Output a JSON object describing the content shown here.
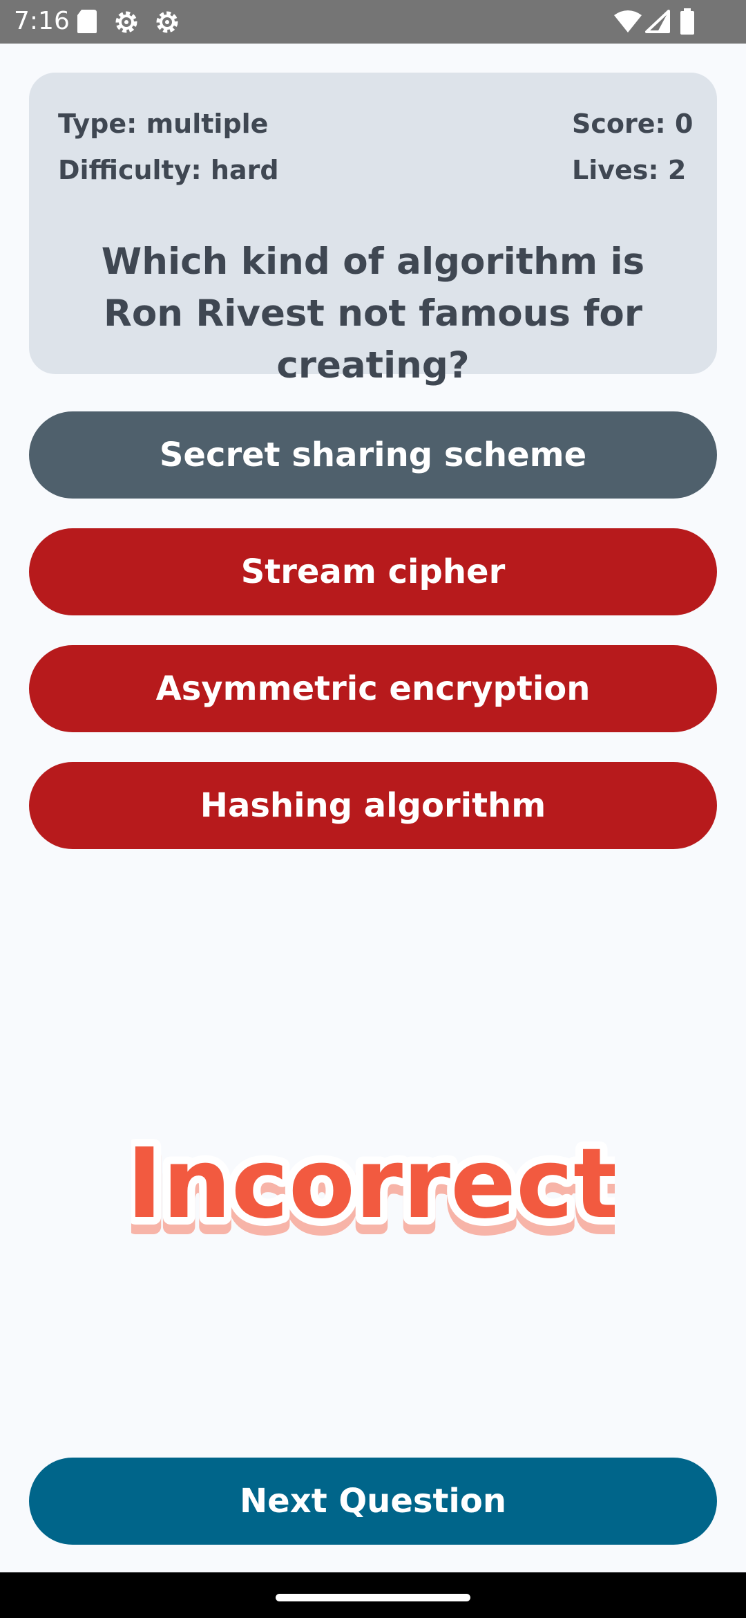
{
  "status_bar": {
    "time": "7:16",
    "icons": [
      "sd-card-icon",
      "settings-icon",
      "settings-icon",
      "wifi-icon",
      "signal-icon",
      "battery-icon"
    ]
  },
  "quiz": {
    "type_label": "Type: multiple",
    "difficulty_label": "Difficulty: hard",
    "score_label": "Score: 0",
    "lives_label": "Lives: 2",
    "question": "Which kind of algorithm is Ron Rivest not famous for creating?"
  },
  "answers": [
    {
      "label": "Secret sharing scheme",
      "state": "correct"
    },
    {
      "label": "Stream cipher",
      "state": "wrong"
    },
    {
      "label": "Asymmetric encryption",
      "state": "wrong"
    },
    {
      "label": "Hashing algorithm",
      "state": "wrong"
    }
  ],
  "result": {
    "text": "Incorrect"
  },
  "next_button": {
    "label": "Next Question"
  },
  "colors": {
    "correct_answer": "#4f606c",
    "wrong_answer": "#b71a1c",
    "next_button": "#00658a",
    "result_text": "#f25a40",
    "card_bg": "#dde3ea"
  }
}
